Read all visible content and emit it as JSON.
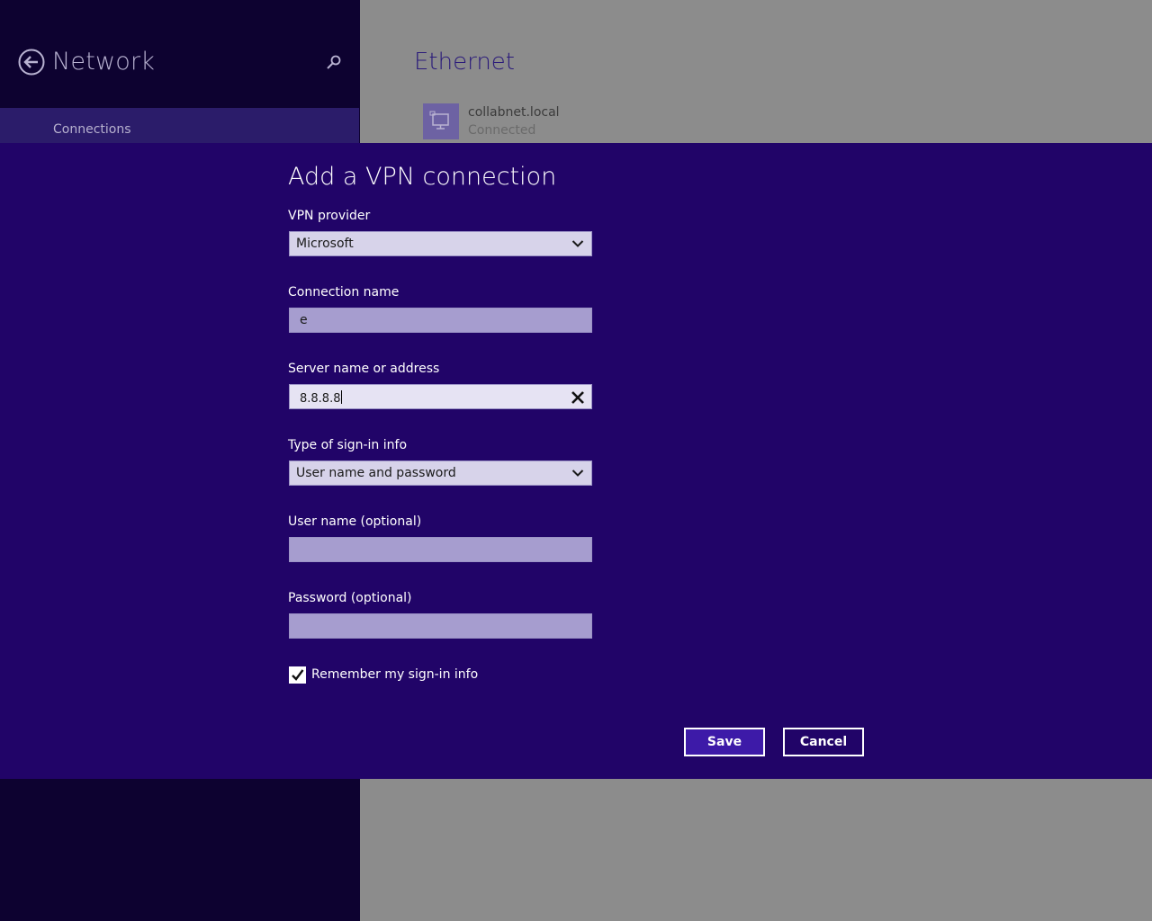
{
  "left_pane": {
    "title": "Network",
    "back_icon": "back-arrow-circle-icon",
    "search_icon": "search-icon",
    "selected_item": "Connections"
  },
  "right_pane": {
    "section_title": "Ethernet",
    "network": {
      "icon": "network-icon",
      "name": "collabnet.local",
      "status": "Connected"
    }
  },
  "dialog": {
    "title": "Add a VPN connection",
    "vpn_provider": {
      "label": "VPN provider",
      "value": "Microsoft"
    },
    "connection_name": {
      "label": "Connection name",
      "value": "e"
    },
    "server": {
      "label": "Server name or address",
      "value": "8.8.8.8"
    },
    "sign_in_type": {
      "label": "Type of sign-in info",
      "value": "User name and password"
    },
    "username": {
      "label": "User name (optional)",
      "value": ""
    },
    "password": {
      "label": "Password (optional)",
      "value": ""
    },
    "remember": {
      "label": "Remember my sign-in info",
      "checked": true
    },
    "save_label": "Save",
    "cancel_label": "Cancel"
  },
  "colors": {
    "dialog_bg": "#210468",
    "left_pane_bg": "#0d0230",
    "right_pane_bg": "#8c8c8c",
    "accent": "#3d1aa8"
  }
}
